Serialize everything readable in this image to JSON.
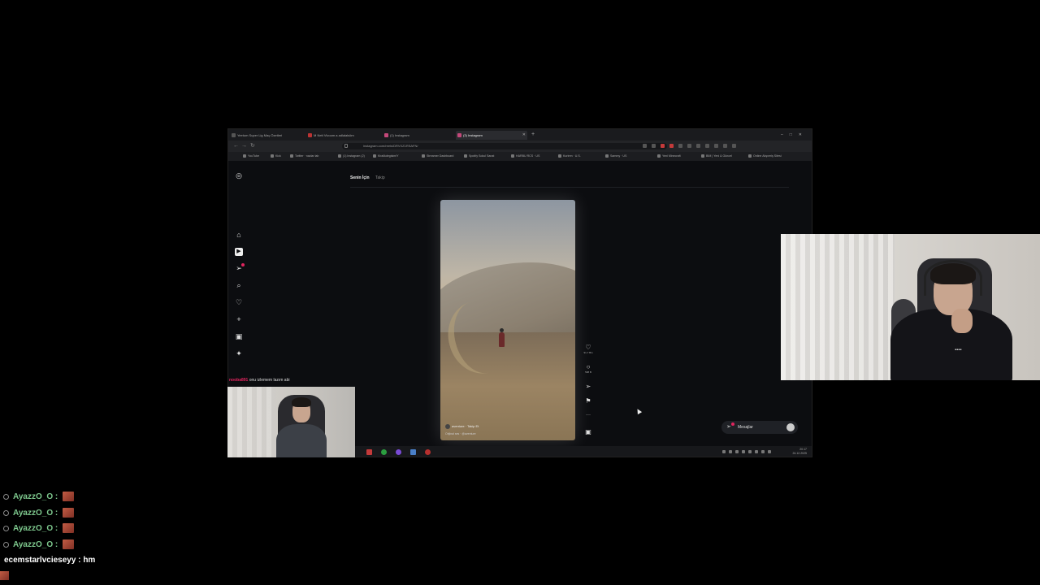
{
  "browser": {
    "tabs": [
      {
        "label": "Yeetum Super Lig Maç Özetleri"
      },
      {
        "label": "M Nett Vivoom a adlalalsöm"
      },
      {
        "label": "(1) Instagram"
      },
      {
        "label": "(3) Instagram"
      }
    ],
    "url": "instagram.com/reels/DRVXZ1RSAFN/",
    "bookmarks": [
      "YouTube",
      "Kick",
      "Twitter · nazlar lab",
      "(1) Instagram (2)",
      "Kiralikdegisim/Y",
      "Streamer Dashboard",
      "Spotify Sokul Sanat",
      "HARBU RCS · US",
      "Kuriren · U.S.",
      "Sammy · US",
      "Yeni Minecraft",
      "BIM | Yeni & Güncel",
      "Online Alışveriş Sitesi"
    ]
  },
  "instagram": {
    "feed_tabs": {
      "active": "Senin İçin",
      "inactive": "Takip"
    },
    "sidebar_icons": [
      "instagram-icon",
      "home-icon",
      "reels-icon",
      "send-icon",
      "search-icon",
      "heart-icon",
      "plus-icon",
      "dashboard-icon",
      "more-icon"
    ],
    "reel": {
      "username": "aventure",
      "follow_label": "Takip Et",
      "audio": "Orijinal ses · @aventure"
    },
    "actions": {
      "likes": "91,7 Bin",
      "comments": "508 B"
    },
    "messages_label": "Mesajlar"
  },
  "inner_chat": {
    "user": "nooba891",
    "message": "onu izlemem lazım abi"
  },
  "taskbar": {
    "time": "20:17",
    "date": "24.12.2025"
  },
  "stream_chat": [
    {
      "user": "AyazzO_O :",
      "type": "emote"
    },
    {
      "user": "AyazzO_O :",
      "type": "emote"
    },
    {
      "user": "AyazzO_O :",
      "type": "emote"
    },
    {
      "user": "AyazzO_O :",
      "type": "emote"
    },
    {
      "user": "ecemstarlvcieseyy :",
      "message": "hm",
      "type": "text"
    }
  ],
  "colors": {
    "chat_user": "#7ec98e",
    "notification": "#e0245e",
    "background": "#000000"
  }
}
